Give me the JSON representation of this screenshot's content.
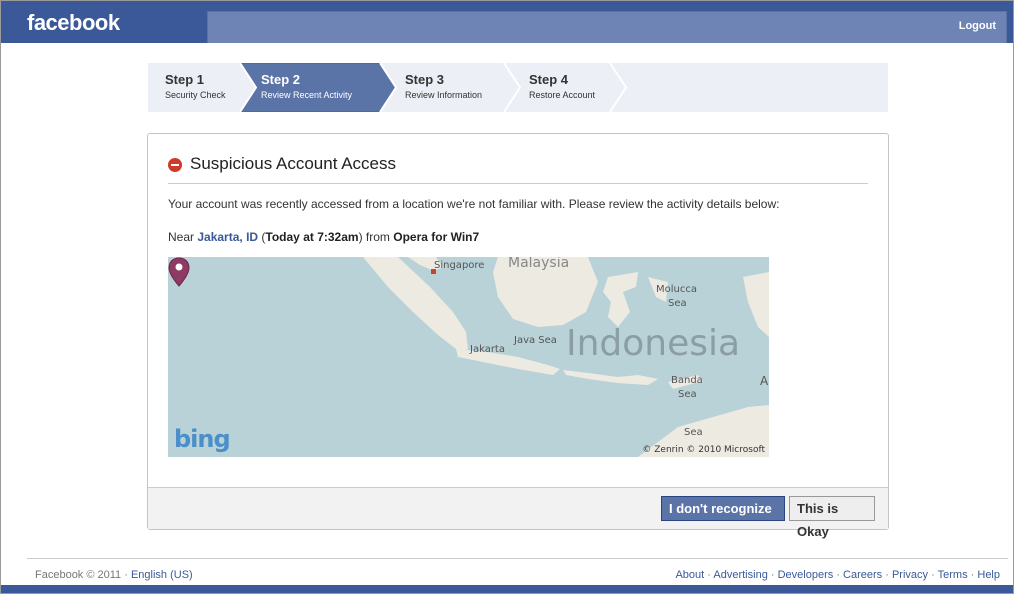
{
  "header": {
    "logo": "facebook",
    "logout": "Logout"
  },
  "steps": [
    {
      "num": "Step 1",
      "desc": "Security Check",
      "active": false
    },
    {
      "num": "Step 2",
      "desc": "Review Recent Activity",
      "active": true
    },
    {
      "num": "Step 3",
      "desc": "Review Information",
      "active": false
    },
    {
      "num": "Step 4",
      "desc": "Restore Account",
      "active": false
    }
  ],
  "panel": {
    "title": "Suspicious Account Access",
    "intro": "Your account was recently accessed from a location we're not familiar with. Please review the activity details below:",
    "near": "Near",
    "city": "Jakarta, ID",
    "paren_open": "(",
    "time": "Today at 7:32am",
    "paren_close": ") from",
    "browser": "Opera for Win7"
  },
  "map": {
    "labels": {
      "singapore": "Singapore",
      "malaysia": "Malaysia",
      "molucca": "Molucca",
      "molucca_sea": "Sea",
      "java_sea": "Java Sea",
      "jakarta": "Jakarta",
      "indonesia": "Indonesia",
      "banda": "Banda",
      "banda_sea": "Sea",
      "timor_sea": "Sea",
      "edge_a": "A"
    },
    "brand": "bing",
    "copyright": "© Zenrin © 2010 Microsoft"
  },
  "buttons": {
    "dont_recognize": "I don't recognize",
    "okay": "This is Okay"
  },
  "footer": {
    "copyright": "Facebook © 2011 ·",
    "language": "English (US)",
    "links": [
      "About",
      "Advertising",
      "Developers",
      "Careers",
      "Privacy",
      "Terms",
      "Help"
    ],
    "separator": "·"
  },
  "colors": {
    "brand_blue": "#3b5998",
    "button_blue": "#5b74a8",
    "alert_red": "#d03a2b",
    "map_water": "#b9d2d8",
    "map_land": "#edeae2"
  }
}
